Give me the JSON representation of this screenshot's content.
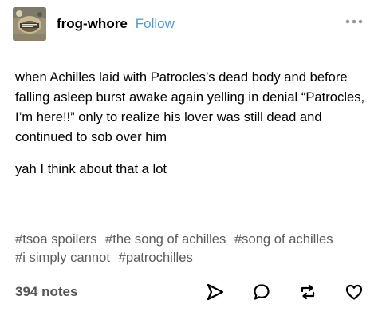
{
  "post": {
    "blog_name": "frog-whore",
    "follow_label": "Follow",
    "paragraphs": [
      "when Achilles laid with Patrocles’s dead body and before falling asleep burst awake again yelling in denial “Patrocles, I’m here!!” only to realize his lover was still dead and continued to sob over him",
      "yah I think about that a lot"
    ],
    "tags": [
      "#tsoa spoilers",
      "#the song of achilles",
      "#song of achilles",
      "#i simply cannot",
      "#patrochilles"
    ],
    "notes_label": "394 notes"
  },
  "icons": {
    "more": "more-options-icon",
    "share": "share-send-icon",
    "reply": "reply-speech-bubble-icon",
    "reblog": "reblog-icon",
    "like": "heart-icon"
  },
  "colors": {
    "follow": "#4c9bd8",
    "tags": "#5b5b5b",
    "notes": "#555555",
    "icons": "#000000"
  }
}
